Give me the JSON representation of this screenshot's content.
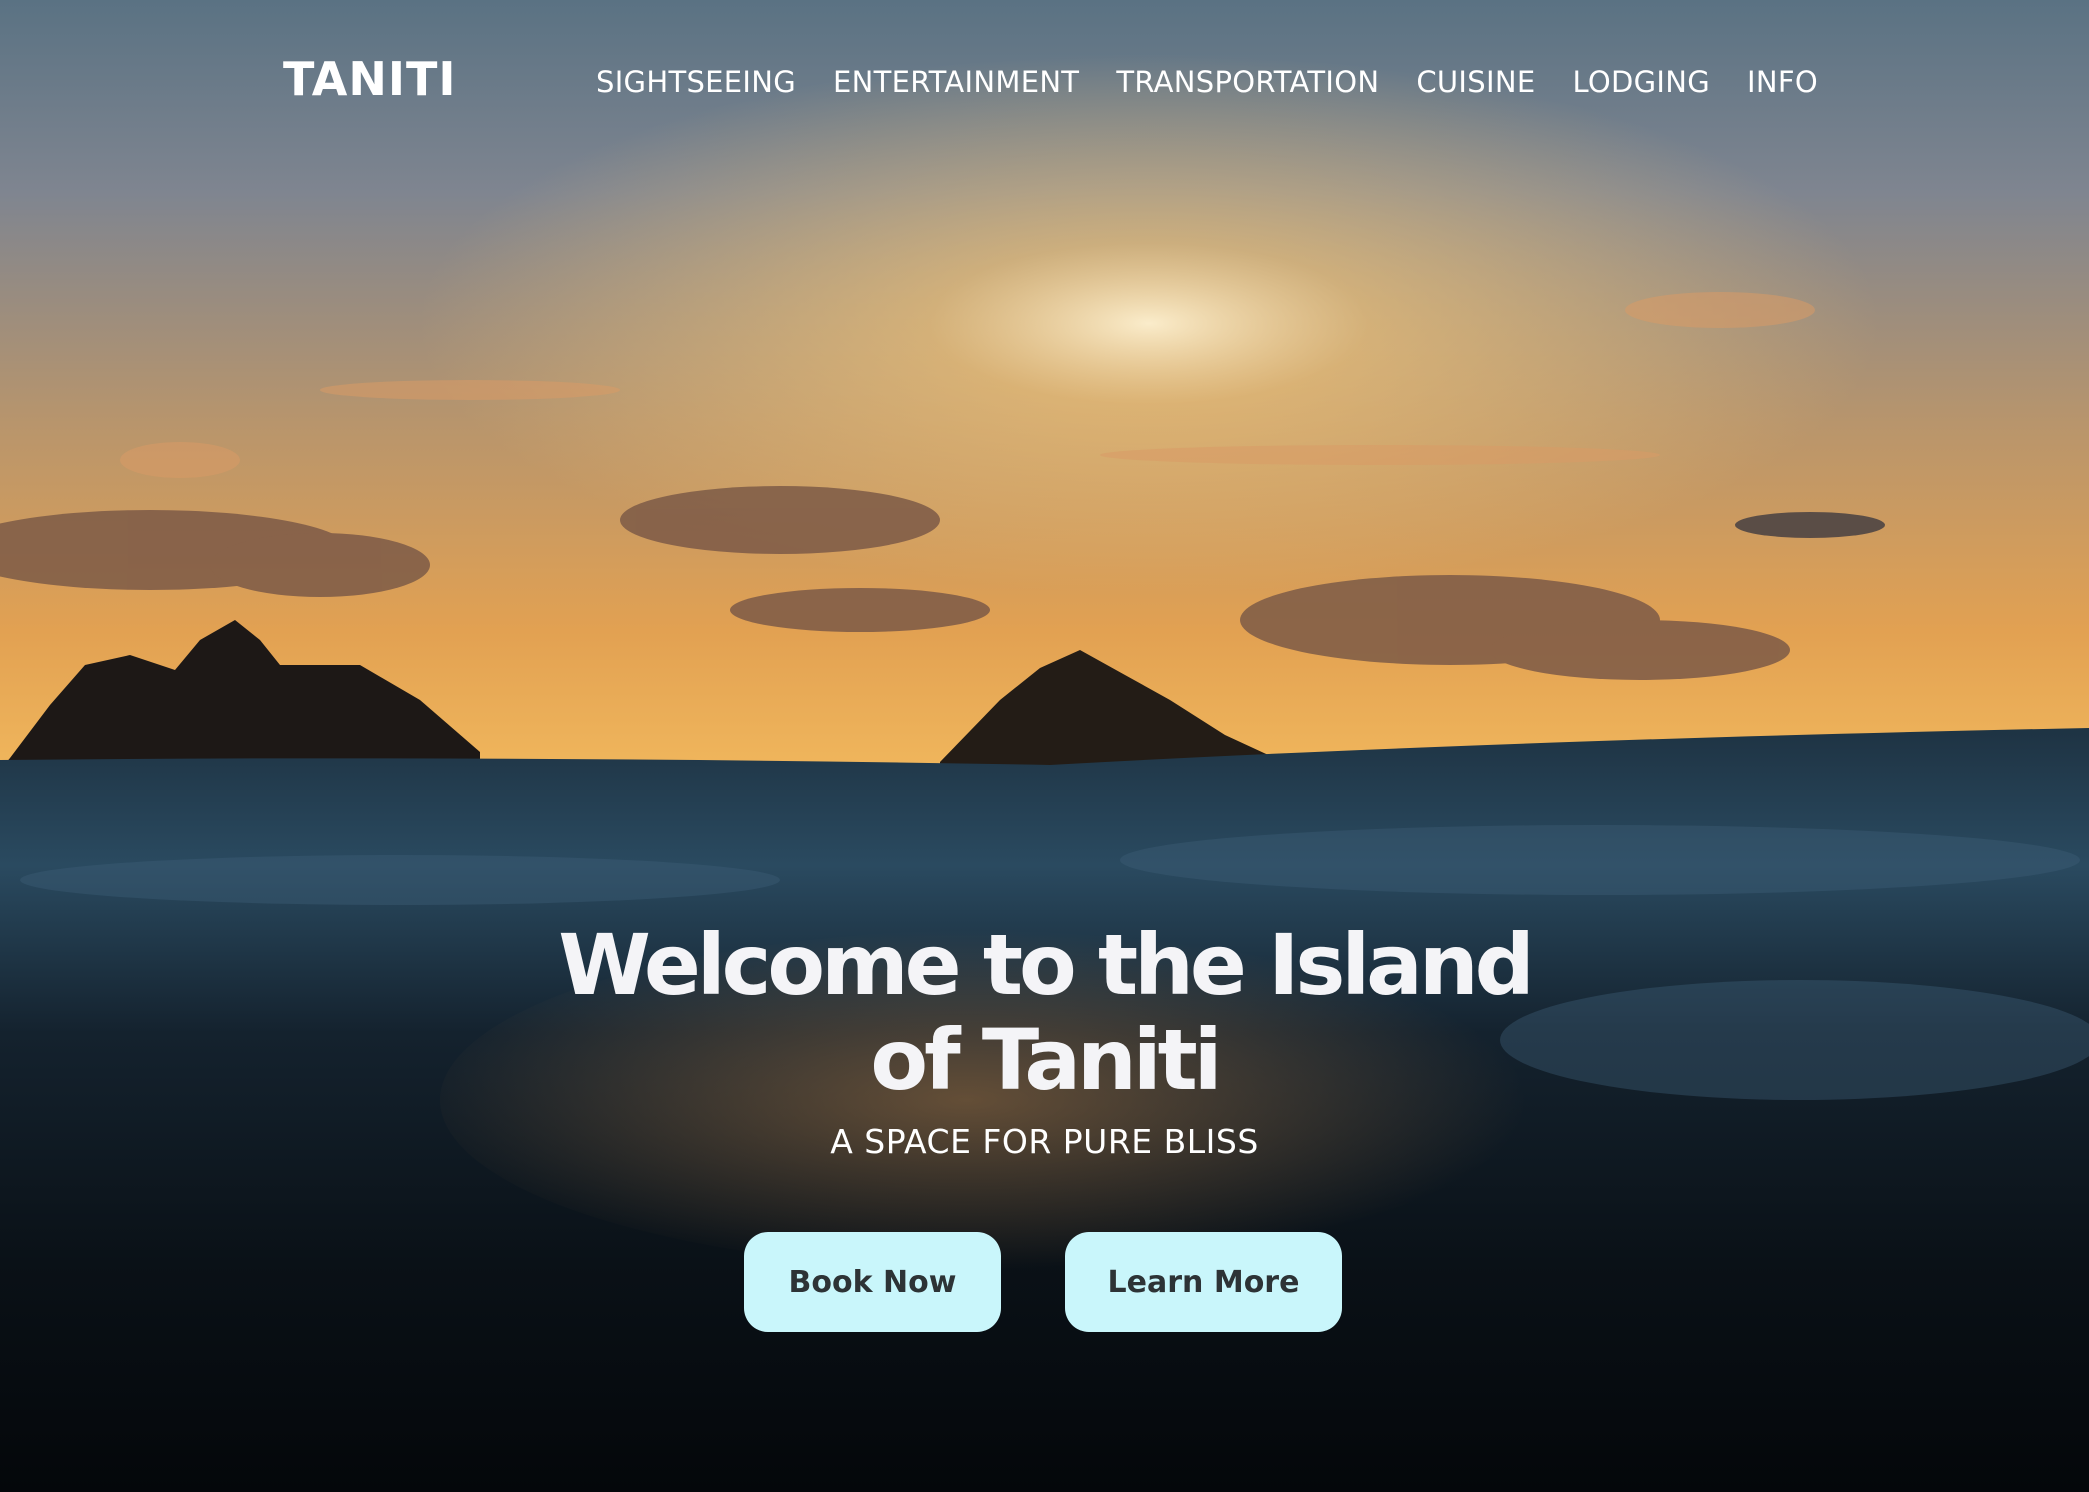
{
  "brand": {
    "name": "TANITI"
  },
  "nav": {
    "items": [
      {
        "label": "SIGHTSEEING"
      },
      {
        "label": "ENTERTAINMENT"
      },
      {
        "label": "TRANSPORTATION"
      },
      {
        "label": "CUISINE"
      },
      {
        "label": "LODGING"
      },
      {
        "label": "INFO"
      }
    ]
  },
  "hero": {
    "title": "Welcome to the Island of Taniti",
    "subtitle": "A SPACE FOR PURE BLISS",
    "primary_button": "Book Now",
    "secondary_button": "Learn More",
    "background_image": "sunset-ocean-islands"
  },
  "colors": {
    "button_bg": "#c9f6fb",
    "button_text": "#2d3336",
    "text": "#ffffff"
  }
}
